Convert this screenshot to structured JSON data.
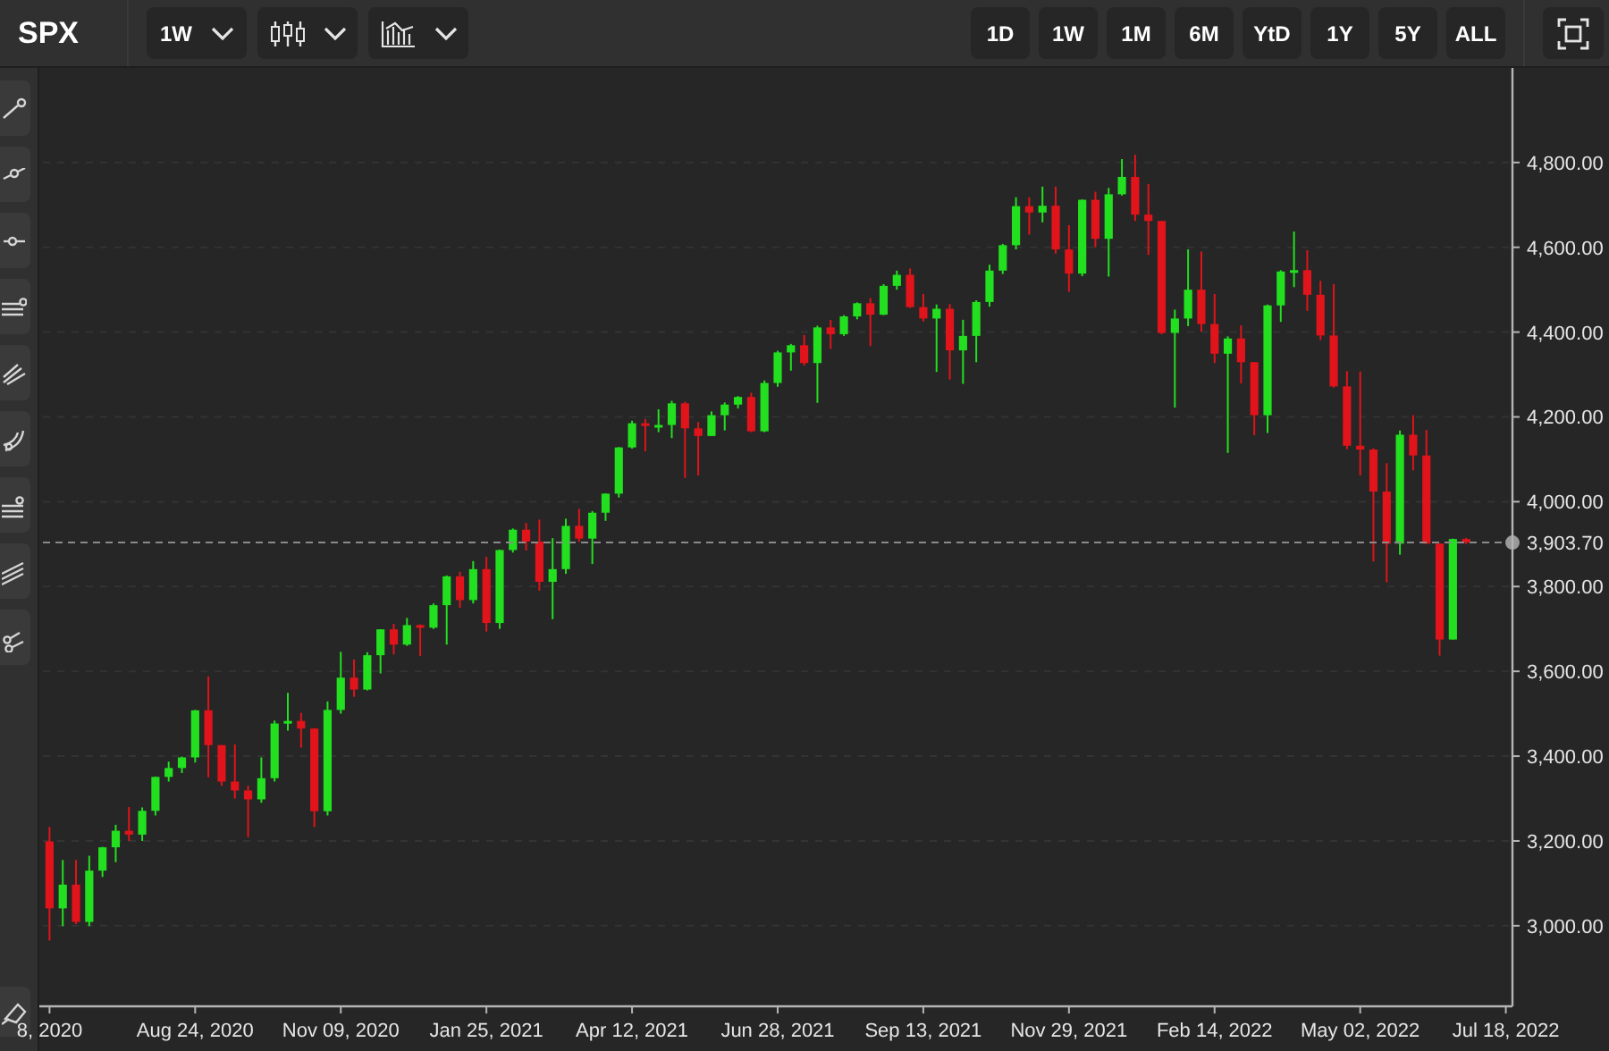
{
  "symbol": "SPX",
  "interval": {
    "value": "1W"
  },
  "ranges": [
    {
      "label": "1D"
    },
    {
      "label": "1W"
    },
    {
      "label": "1M"
    },
    {
      "label": "6M"
    },
    {
      "label": "YtD"
    },
    {
      "label": "1Y"
    },
    {
      "label": "5Y"
    },
    {
      "label": "ALL"
    }
  ],
  "chart": {
    "chart_data": {
      "type": "candlestick",
      "ylim": [
        2810,
        5023
      ],
      "categories": [
        "8, 2020",
        null,
        null,
        null,
        null,
        null,
        null,
        null,
        null,
        null,
        null,
        "Aug 24, 2020",
        null,
        null,
        null,
        null,
        null,
        null,
        null,
        null,
        null,
        null,
        "Nov 09, 2020",
        null,
        null,
        null,
        null,
        null,
        null,
        null,
        null,
        null,
        null,
        "Jan 25, 2021",
        null,
        null,
        null,
        null,
        null,
        null,
        null,
        null,
        null,
        null,
        "Apr 12, 2021",
        null,
        null,
        null,
        null,
        null,
        null,
        null,
        null,
        null,
        null,
        "Jun 28, 2021",
        null,
        null,
        null,
        null,
        null,
        null,
        null,
        null,
        null,
        null,
        "Sep 13, 2021",
        null,
        null,
        null,
        null,
        null,
        null,
        null,
        null,
        null,
        null,
        "Nov 29, 2021",
        null,
        null,
        null,
        null,
        null,
        null,
        null,
        null,
        null,
        null,
        "Feb 14, 2022",
        null,
        null,
        null,
        null,
        null,
        null,
        null,
        null,
        null,
        null,
        "May 02, 2022",
        null,
        null,
        null,
        null,
        null,
        null,
        null,
        null,
        null,
        null,
        "Jul 18, 2022"
      ],
      "ohlc": [
        [
          3199,
          3233,
          2965,
          3041
        ],
        [
          3041,
          3155,
          2999,
          3097
        ],
        [
          3097,
          3155,
          3004,
          3009
        ],
        [
          3009,
          3165,
          2999,
          3130
        ],
        [
          3130,
          3186,
          3115,
          3185
        ],
        [
          3185,
          3238,
          3150,
          3224
        ],
        [
          3224,
          3280,
          3200,
          3215
        ],
        [
          3215,
          3279,
          3200,
          3271
        ],
        [
          3271,
          3352,
          3260,
          3351
        ],
        [
          3351,
          3387,
          3340,
          3372
        ],
        [
          3372,
          3399,
          3360,
          3397
        ],
        [
          3397,
          3509,
          3385,
          3508
        ],
        [
          3508,
          3588,
          3350,
          3426
        ],
        [
          3426,
          3426,
          3330,
          3340
        ],
        [
          3340,
          3428,
          3300,
          3319
        ],
        [
          3319,
          3330,
          3209,
          3298
        ],
        [
          3298,
          3397,
          3290,
          3348
        ],
        [
          3348,
          3484,
          3340,
          3477
        ],
        [
          3477,
          3549,
          3460,
          3483
        ],
        [
          3483,
          3502,
          3420,
          3465
        ],
        [
          3465,
          3466,
          3233,
          3270
        ],
        [
          3270,
          3529,
          3260,
          3509
        ],
        [
          3509,
          3646,
          3500,
          3585
        ],
        [
          3585,
          3628,
          3540,
          3557
        ],
        [
          3557,
          3645,
          3555,
          3638
        ],
        [
          3638,
          3699,
          3595,
          3699
        ],
        [
          3699,
          3712,
          3640,
          3663
        ],
        [
          3663,
          3726,
          3660,
          3709
        ],
        [
          3709,
          3711,
          3636,
          3703
        ],
        [
          3703,
          3760,
          3700,
          3756
        ],
        [
          3756,
          3826,
          3663,
          3824
        ],
        [
          3824,
          3835,
          3750,
          3768
        ],
        [
          3768,
          3860,
          3760,
          3841
        ],
        [
          3841,
          3870,
          3694,
          3714
        ],
        [
          3714,
          3887,
          3700,
          3886
        ],
        [
          3886,
          3937,
          3880,
          3934
        ],
        [
          3934,
          3950,
          3885,
          3906
        ],
        [
          3906,
          3958,
          3790,
          3811
        ],
        [
          3811,
          3914,
          3723,
          3841
        ],
        [
          3841,
          3960,
          3830,
          3943
        ],
        [
          3943,
          3983,
          3905,
          3913
        ],
        [
          3913,
          3978,
          3853,
          3974
        ],
        [
          3974,
          4020,
          3955,
          4019
        ],
        [
          4019,
          4129,
          4010,
          4128
        ],
        [
          4128,
          4191,
          4125,
          4185
        ],
        [
          4185,
          4195,
          4119,
          4180
        ],
        [
          4180,
          4218,
          4164,
          4181
        ],
        [
          4181,
          4238,
          4150,
          4232
        ],
        [
          4232,
          4236,
          4056,
          4173
        ],
        [
          4173,
          4188,
          4062,
          4155
        ],
        [
          4155,
          4213,
          4155,
          4204
        ],
        [
          4204,
          4234,
          4168,
          4229
        ],
        [
          4229,
          4249,
          4220,
          4247
        ],
        [
          4247,
          4257,
          4164,
          4166
        ],
        [
          4166,
          4286,
          4164,
          4280
        ],
        [
          4280,
          4356,
          4271,
          4352
        ],
        [
          4352,
          4372,
          4309,
          4369
        ],
        [
          4369,
          4393,
          4321,
          4327
        ],
        [
          4327,
          4415,
          4233,
          4411
        ],
        [
          4411,
          4429,
          4360,
          4395
        ],
        [
          4395,
          4440,
          4391,
          4437
        ],
        [
          4437,
          4470,
          4430,
          4468
        ],
        [
          4468,
          4480,
          4367,
          4441
        ],
        [
          4441,
          4513,
          4440,
          4509
        ],
        [
          4509,
          4545,
          4500,
          4535
        ],
        [
          4535,
          4550,
          4457,
          4459
        ],
        [
          4459,
          4490,
          4425,
          4432
        ],
        [
          4432,
          4465,
          4306,
          4455
        ],
        [
          4455,
          4466,
          4288,
          4357
        ],
        [
          4357,
          4429,
          4278,
          4391
        ],
        [
          4391,
          4475,
          4329,
          4471
        ],
        [
          4471,
          4559,
          4460,
          4545
        ],
        [
          4545,
          4608,
          4537,
          4605
        ],
        [
          4605,
          4718,
          4595,
          4697
        ],
        [
          4697,
          4718,
          4630,
          4682
        ],
        [
          4682,
          4743,
          4659,
          4698
        ],
        [
          4698,
          4743,
          4585,
          4595
        ],
        [
          4595,
          4652,
          4495,
          4538
        ],
        [
          4538,
          4713,
          4532,
          4712
        ],
        [
          4712,
          4731,
          4600,
          4620
        ],
        [
          4620,
          4740,
          4531,
          4725
        ],
        [
          4725,
          4808,
          4722,
          4766
        ],
        [
          4766,
          4818,
          4662,
          4677
        ],
        [
          4677,
          4749,
          4582,
          4662
        ],
        [
          4662,
          4662,
          4395,
          4398
        ],
        [
          4398,
          4453,
          4222,
          4432
        ],
        [
          4432,
          4595,
          4414,
          4500
        ],
        [
          4500,
          4590,
          4401,
          4419
        ],
        [
          4419,
          4490,
          4327,
          4349
        ],
        [
          4349,
          4390,
          4115,
          4385
        ],
        [
          4385,
          4416,
          4279,
          4329
        ],
        [
          4329,
          4329,
          4157,
          4204
        ],
        [
          4204,
          4465,
          4162,
          4463
        ],
        [
          4463,
          4546,
          4424,
          4543
        ],
        [
          4543,
          4637,
          4506,
          4546
        ],
        [
          4546,
          4593,
          4450,
          4488
        ],
        [
          4488,
          4521,
          4381,
          4392
        ],
        [
          4392,
          4513,
          4269,
          4272
        ],
        [
          4272,
          4308,
          4124,
          4132
        ],
        [
          4132,
          4307,
          4062,
          4123
        ],
        [
          4123,
          4126,
          3859,
          4024
        ],
        [
          4024,
          4091,
          3810,
          3901
        ],
        [
          3901,
          4168,
          3875,
          4158
        ],
        [
          4158,
          4204,
          4074,
          4109
        ],
        [
          4109,
          4169,
          3901,
          3901
        ],
        [
          3901,
          3902,
          3637,
          3675
        ],
        [
          3675,
          3913,
          3675,
          3912
        ],
        [
          3912,
          3915,
          3900,
          3904
        ],
        null,
        null,
        null
      ],
      "yticks": [
        {
          "value": 4800,
          "label": "4,800.00"
        },
        {
          "value": 4600,
          "label": "4,600.00"
        },
        {
          "value": 4400,
          "label": "4,400.00"
        },
        {
          "value": 4200,
          "label": "4,200.00"
        },
        {
          "value": 4000,
          "label": "4,000.00"
        },
        {
          "value": 3800,
          "label": "3,800.00"
        },
        {
          "value": 3600,
          "label": "3,600.00"
        },
        {
          "value": 3400,
          "label": "3,400.00"
        },
        {
          "value": 3200,
          "label": "3,200.00"
        },
        {
          "value": 3000,
          "label": "3,000.00"
        }
      ],
      "grid": true,
      "ref_lines": [
        {
          "axis": "y",
          "value": 3903.7,
          "label": "3,903.70"
        }
      ]
    }
  }
}
